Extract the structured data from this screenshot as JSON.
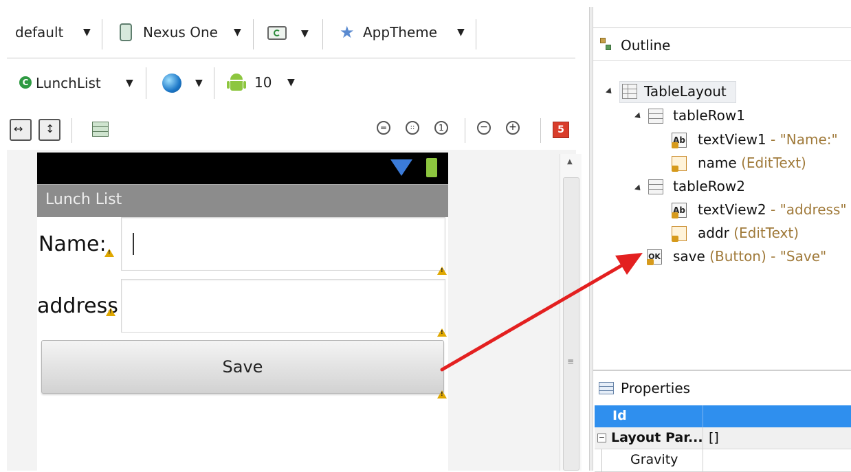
{
  "toolbar1": {
    "config": "default",
    "device": "Nexus One",
    "theme": "AppTheme"
  },
  "toolbar2": {
    "activity": "LunchList",
    "api_level": "10"
  },
  "canvas_toolbar": {
    "error_count": "5"
  },
  "device_screen": {
    "app_title": "Lunch List",
    "name_label": "Name:",
    "address_label": "address",
    "save_button": "Save"
  },
  "outline": {
    "title": "Outline",
    "items": [
      {
        "name": "TableLayout",
        "meta": ""
      },
      {
        "name": "tableRow1",
        "meta": ""
      },
      {
        "name": "textView1",
        "meta": " - \"Name:\""
      },
      {
        "name": "name",
        "meta": " (EditText)"
      },
      {
        "name": "tableRow2",
        "meta": ""
      },
      {
        "name": "textView2",
        "meta": " - \"address\""
      },
      {
        "name": "addr",
        "meta": " (EditText)"
      },
      {
        "name": "save",
        "meta": " (Button) - \"Save\""
      }
    ]
  },
  "properties": {
    "title": "Properties",
    "rows": [
      {
        "key": "Id",
        "value": ""
      },
      {
        "key": "Layout Par...",
        "value": "[]"
      },
      {
        "key": "Gravity",
        "value": ""
      }
    ]
  },
  "colors": {
    "selection": "#2f8fee",
    "arrow": "#e32020",
    "error_badge": "#d93d2b",
    "android_green": "#8dc63f"
  }
}
